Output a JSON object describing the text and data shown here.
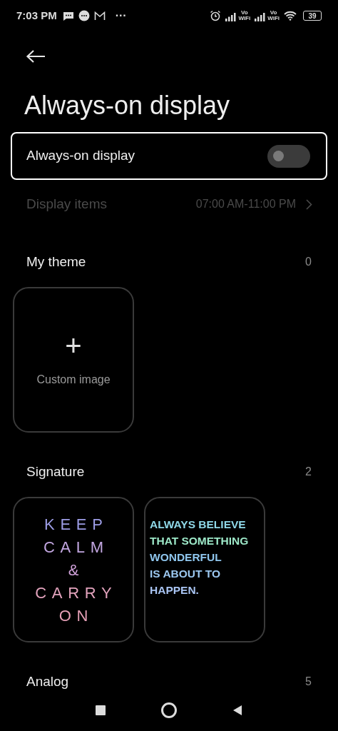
{
  "status_bar": {
    "time": "7:03 PM",
    "more": "···",
    "volte": [
      {
        "top": "Vo",
        "bottom": "WiFi"
      },
      {
        "top": "Vo",
        "bottom": "WiFi"
      }
    ],
    "battery": "39"
  },
  "title": "Always-on display",
  "toggle_row": {
    "label": "Always-on display",
    "on": false
  },
  "display_items": {
    "label": "Display items",
    "value": "07:00 AM-11:00 PM",
    "disabled": true
  },
  "sections": [
    {
      "title": "My theme",
      "count": "0",
      "cards": [
        {
          "kind": "custom",
          "plus": "+",
          "label": "Custom image"
        }
      ]
    },
    {
      "title": "Signature",
      "count": "2",
      "cards": [
        {
          "kind": "spaced",
          "lines": [
            {
              "text": "KEEP",
              "color": "#9d9de6"
            },
            {
              "text": "CALM",
              "color": "#c2a6e0"
            },
            {
              "text": "&",
              "color": "#cfa0d8"
            },
            {
              "text": "CARRY",
              "color": "#e3a3bd"
            },
            {
              "text": "ON",
              "color": "#e59fb6"
            }
          ]
        },
        {
          "kind": "bold",
          "lines": [
            {
              "text": "ALWAYS BELIEVE",
              "color": "#8fd8e8"
            },
            {
              "text": "THAT SOMETHING",
              "color": "#9de8c8"
            },
            {
              "text": "WONDERFUL",
              "color": "#8fc6ee"
            },
            {
              "text": "IS ABOUT TO",
              "color": "#9cc8f0"
            },
            {
              "text": "HAPPEN.",
              "color": "#a9c4f2"
            }
          ]
        }
      ]
    },
    {
      "title": "Analog",
      "count": "5"
    }
  ]
}
